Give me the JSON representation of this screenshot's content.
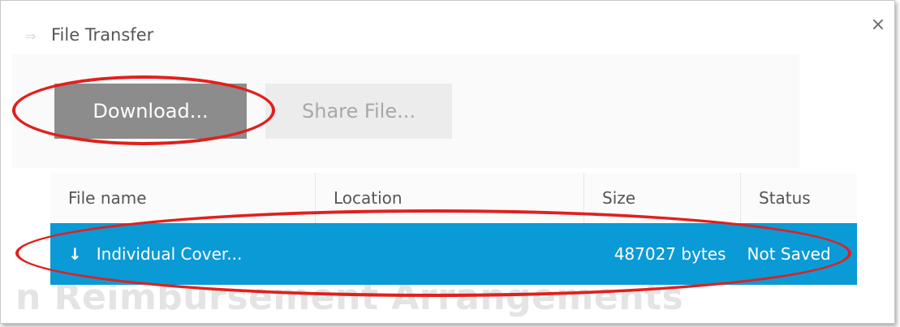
{
  "dialog": {
    "title": "File Transfer",
    "close_label": "×"
  },
  "toolbar": {
    "download_label": "Download...",
    "share_label": "Share File..."
  },
  "table": {
    "columns": [
      "File name",
      "Location",
      "Size",
      "Status"
    ],
    "rows": [
      {
        "direction_icon": "↓",
        "file_name": "Individual Cover...",
        "location": "",
        "size": "487027 bytes",
        "status": "Not Saved"
      }
    ]
  },
  "background": {
    "heading": "n Reimbursement Arrangements"
  },
  "colors": {
    "selection": "#0a9ad6",
    "download_button": "#8c8c8c",
    "annotation": "#e1201d"
  }
}
